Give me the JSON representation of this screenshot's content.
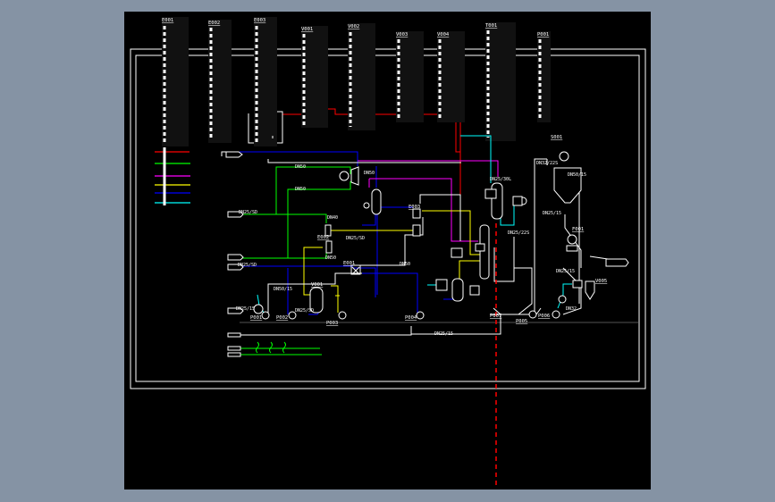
{
  "colors": {
    "background": "#8593a4",
    "canvas": "#000000",
    "frame": "#ffffff",
    "block": "#111111",
    "line_red": "#ff0000",
    "line_green": "#00ff00",
    "line_magenta": "#ff00ff",
    "line_yellow": "#ffff00",
    "line_blue": "#0000ff",
    "line_cyan": "#00ffff",
    "centerline": "#ff0000"
  },
  "equipment_blocks": [
    {
      "tag": "E001"
    },
    {
      "tag": "E002"
    },
    {
      "tag": "E003"
    },
    {
      "tag": "V001"
    },
    {
      "tag": "V002"
    },
    {
      "tag": "V003"
    },
    {
      "tag": "V004"
    },
    {
      "tag": "T001"
    },
    {
      "tag": "P001"
    }
  ],
  "legend": {
    "line_colors": [
      "red",
      "green",
      "magenta",
      "yellow",
      "blue",
      "cyan"
    ]
  },
  "line_labels": {
    "l1": "DN50",
    "l2": "DN50",
    "l3": "DN50",
    "l4": "DN25/SD",
    "l5": "DN40",
    "l6": "DN50",
    "l7": "DN50",
    "l8": "DN25/SD",
    "l9": "DN25/SD",
    "l10": "DN25/15",
    "l11": "DN25/SD",
    "l12": "DN25/15",
    "l13": "DN25/30L",
    "l14": "DN25/22S",
    "l15": "DN32/22S",
    "l16": "DN50/15",
    "l17": "DN25/15",
    "l18": "DN32",
    "l19": "DN25/15",
    "l20": "DN50/15"
  },
  "equipment_tags": {
    "e001": "E001",
    "e002": "E002",
    "e003": "E003",
    "v001": "V001",
    "p001": "P001",
    "p002": "P002",
    "p003": "P003",
    "p004": "P004",
    "p005": "P005",
    "p006": "P006",
    "p007": "P007",
    "s001": "S001",
    "f001": "F001",
    "v005": "V005"
  }
}
